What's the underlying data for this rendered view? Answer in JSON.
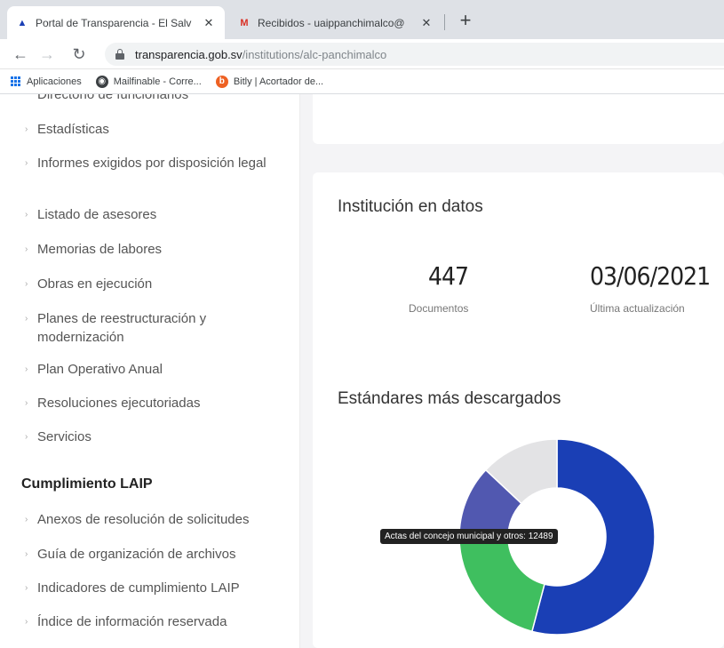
{
  "browser": {
    "tabs": [
      {
        "title": "Portal de Transparencia - El Salv",
        "active": true
      },
      {
        "title": "Recibidos - uaippanchimalco@",
        "active": false
      }
    ],
    "new_tab": "+",
    "url_host": "transparencia.gob.sv",
    "url_path": "/institutions/alc-panchimalco",
    "bookmarks": [
      {
        "label": "Aplicaciones",
        "icon": "apps-grid-icon"
      },
      {
        "label": "Mailfinable - Corre...",
        "icon": "mailfinable-icon"
      },
      {
        "label": "Bitly | Acortador de...",
        "icon": "bitly-icon"
      }
    ]
  },
  "sidebar": {
    "cut_item": "Directorio de funcionarios",
    "items": [
      "Estadísticas",
      "Informes exigidos por disposición legal",
      "Listado de asesores",
      "Memorias de labores",
      "Obras en ejecución",
      "Planes de reestructuración y modernización",
      "Plan Operativo Anual",
      "Resoluciones ejecutoriadas",
      "Servicios"
    ],
    "section_heading": "Cumplimiento LAIP",
    "laip_items": [
      "Anexos de resolución de solicitudes",
      "Guía de organización de archivos",
      "Indicadores de cumplimiento LAIP",
      "Índice de información reservada"
    ]
  },
  "main": {
    "institution_title": "Institución en datos",
    "documents_value": "447",
    "documents_label": "Documentos",
    "updated_value": "03/06/2021",
    "updated_label": "Última actualización",
    "standards_title": "Estándares más descargados",
    "tooltip": "Actas del concejo municipal y otros: 12489"
  },
  "chart_data": {
    "type": "pie",
    "title": "Estándares más descargados",
    "slices": [
      {
        "label": "Actas del concejo municipal y otros",
        "value": 12489,
        "color": "#1a3fb5"
      },
      {
        "label": "",
        "value": 4780,
        "color": "#3fbf5f"
      },
      {
        "label": "",
        "value": 2810,
        "color": "#5158b0"
      },
      {
        "label": "",
        "value": 3000,
        "color": "#e3e3e5"
      }
    ],
    "start_angle_deg": 0
  }
}
